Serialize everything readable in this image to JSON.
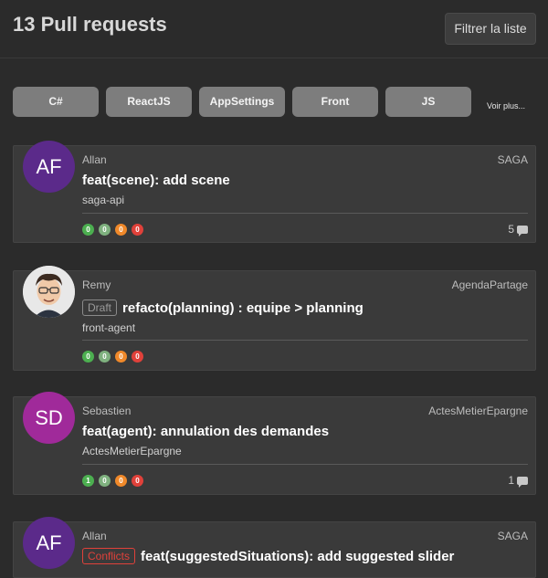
{
  "header": {
    "title": "13 Pull requests",
    "filter_label": "Filtrer la liste"
  },
  "tags": [
    "C#",
    "ReactJS",
    "AppSettings",
    "Front",
    "JS"
  ],
  "more_label": "Voir plus...",
  "colors": {
    "green": "#4caf50",
    "light_green": "#7fb17f",
    "orange": "#f0892a",
    "red": "#e0413a",
    "purple": "#5b2a8a",
    "magenta": "#a02a9a"
  },
  "pull_requests": [
    {
      "avatar": "AF",
      "author": "Allan",
      "repo": "SAGA",
      "title": "feat(scene): add scene",
      "branch": "saga-api",
      "counts": [
        "0",
        "0",
        "0",
        "0"
      ],
      "comments": "5"
    },
    {
      "avatar": "",
      "author": "Remy",
      "repo": "AgendaPartage",
      "badge": "Draft",
      "title": "refacto(planning) : equipe > planning",
      "branch": "front-agent",
      "counts": [
        "0",
        "0",
        "0",
        "0"
      ],
      "comments": ""
    },
    {
      "avatar": "SD",
      "author": "Sebastien",
      "repo": "ActesMetierEpargne",
      "title": "feat(agent): annulation des demandes",
      "branch": "ActesMetierEpargne",
      "counts": [
        "1",
        "0",
        "0",
        "0"
      ],
      "comments": "1"
    },
    {
      "avatar": "AF",
      "author": "Allan",
      "repo": "SAGA",
      "badge": "Conflicts",
      "title": "feat(suggestedSituations): add suggested slider"
    }
  ]
}
